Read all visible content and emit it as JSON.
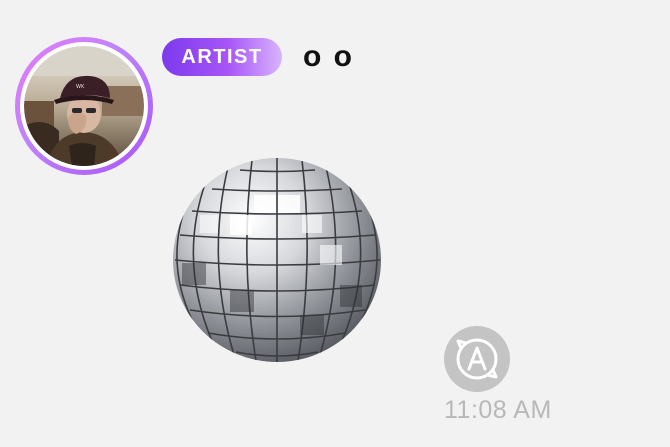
{
  "message": {
    "author": {
      "badge_label": "ARTIST",
      "name": "o o",
      "avatar_icon": "user-photo-avatar"
    },
    "content_emoji": "disco-ball",
    "translate_icon": "translate-icon",
    "timestamp": "11:08 AM"
  },
  "colors": {
    "background": "#f2f2f2",
    "badge_gradient_start": "#7c3aed",
    "badge_gradient_end": "#d8b4fe",
    "avatar_ring_start": "#e879f9",
    "avatar_ring_end": "#a855f7",
    "timestamp": "#b8b8b8",
    "translate_icon": "#c4c4c4"
  }
}
